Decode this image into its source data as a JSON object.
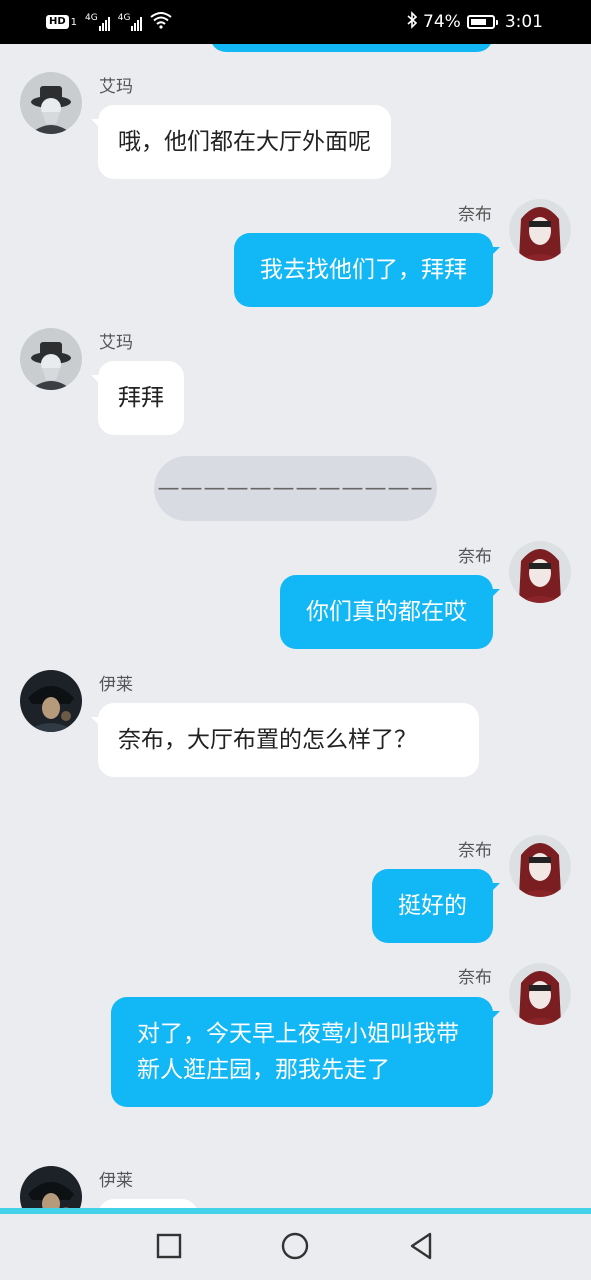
{
  "status_bar": {
    "hd": "HD",
    "sim1": "1",
    "net1": "4G",
    "net2": "4G",
    "battery_percent": "74%",
    "battery_level": 0.74,
    "time": "3:01",
    "icons": [
      "hd-icon",
      "signal-icon",
      "wifi-icon",
      "bluetooth-icon",
      "battery-icon"
    ]
  },
  "messages": [
    {
      "sender": "艾玛",
      "direction": "in",
      "text": "哦，他们都在大厅外面呢"
    },
    {
      "sender": "奈布",
      "direction": "out",
      "text": "我去找他们了，拜拜"
    },
    {
      "sender": "艾玛",
      "direction": "in",
      "text": "拜拜"
    },
    {
      "sender": "奈布",
      "direction": "out",
      "text": "你们真的都在哎"
    },
    {
      "sender": "伊莱",
      "direction": "in",
      "text": "奈布，大厅布置的怎么样了？"
    },
    {
      "sender": "奈布",
      "direction": "out",
      "text": "挺好的"
    },
    {
      "sender": "奈布",
      "direction": "out",
      "text": "对了，今天早上夜莺小姐叫我带新人逛庄园，那我先走了"
    },
    {
      "sender": "伊莱",
      "direction": "in",
      "text": ""
    }
  ],
  "divider": "————————————",
  "navigation": {
    "buttons": [
      "recent-apps-icon",
      "home-icon",
      "back-icon"
    ]
  },
  "colors": {
    "outgoing_bubble": "#12b7f5",
    "incoming_bubble": "#ffffff",
    "background": "#ebecf0",
    "accent_line": "#43d2e8"
  }
}
